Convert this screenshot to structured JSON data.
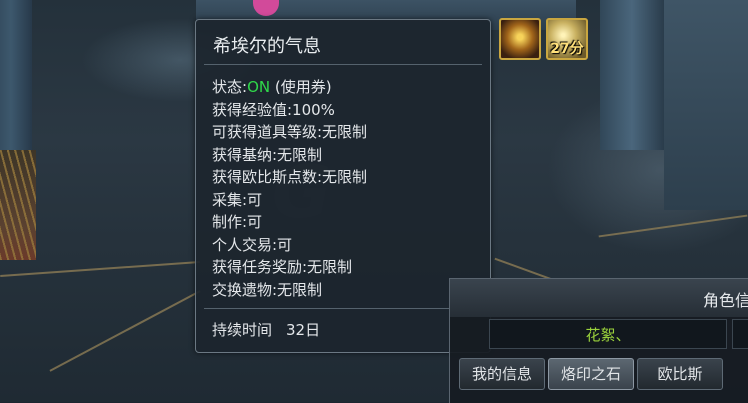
{
  "tooltip": {
    "title": "希埃尔的气息",
    "stats": [
      {
        "label": "状态:",
        "value": "ON",
        "suffix": " (使用券)"
      },
      {
        "text": "获得经验值:100%"
      },
      {
        "text": "可获得道具等级:无限制"
      },
      {
        "text": "获得基纳:无限制"
      },
      {
        "text": "获得欧比斯点数:无限制"
      },
      {
        "text": "采集:可"
      },
      {
        "text": "制作:可"
      },
      {
        "text": "个人交易:可"
      },
      {
        "text": "获得任务奖励:无限制"
      },
      {
        "text": "交换遗物:无限制"
      }
    ],
    "duration_label": "持续时间",
    "duration_value": "32日"
  },
  "buffs": [
    {
      "icon": "golden-shrine-buff-icon"
    },
    {
      "icon": "light-buff-icon",
      "timer": "27分"
    }
  ],
  "panel": {
    "title": "角色信",
    "character_name": "花絮、",
    "tabs": [
      {
        "label": "我的信息",
        "active": false
      },
      {
        "label": "烙印之石",
        "active": true
      },
      {
        "label": "欧比斯",
        "active": false
      }
    ]
  },
  "colors": {
    "on": "#2fd84a",
    "name": "#9bd33c",
    "buff_border": "#c9a640"
  }
}
